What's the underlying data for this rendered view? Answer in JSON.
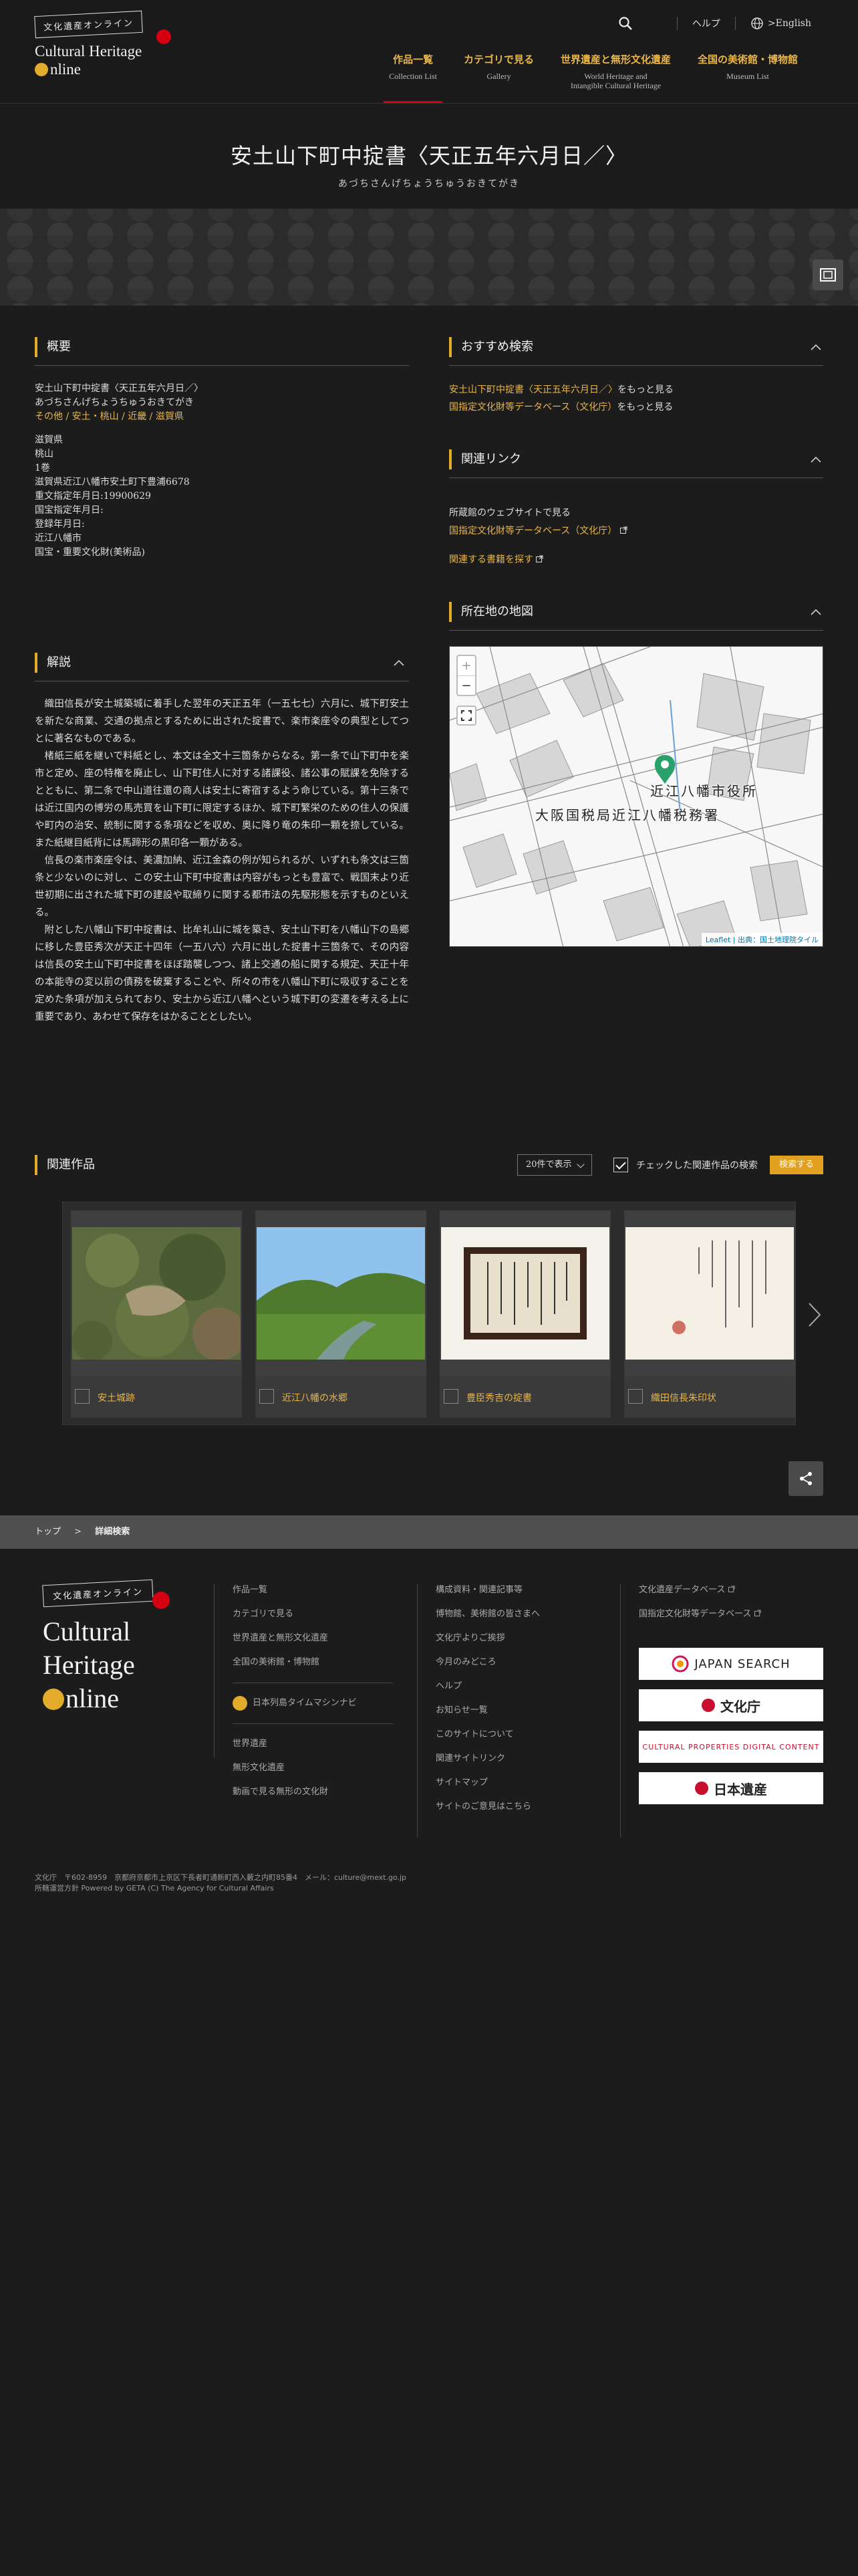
{
  "header": {
    "logo_badge": "文化遺産オンライン",
    "logo_en_1": "Cultural Heritage",
    "logo_en_2": "nline",
    "help": "ヘルプ",
    "lang": ">English",
    "nav": [
      {
        "jp": "作品一覧",
        "en": "Collection List"
      },
      {
        "jp": "カテゴリで見る",
        "en": "Gallery"
      },
      {
        "jp": "世界遺産と無形文化遺産",
        "en": "World Heritage and",
        "en2": "Intangible Cultural Heritage"
      },
      {
        "jp": "全国の美術館・博物館",
        "en": "Museum List"
      }
    ]
  },
  "title": {
    "main": "安土山下町中掟書〈天正五年六月日／〉",
    "kana": "あづちさんげちょうちゅうおきてがき"
  },
  "overview": {
    "heading": "概要",
    "lines_a": [
      "安土山下町中掟書〈天正五年六月日／〉",
      "あづちさんげちょうちゅうおきてがき"
    ],
    "category_link": "その他 / 安土・桃山 / 近畿 / 滋賀県",
    "lines_b": [
      "滋賀県",
      "桃山",
      "1巻",
      "滋賀県近江八幡市安土町下豊浦6678",
      "重文指定年月日:19900629",
      "国宝指定年月日:",
      "登録年月日:",
      "近江八幡市",
      "国宝・重要文化財(美術品)"
    ]
  },
  "commentary": {
    "heading": "解説",
    "paragraphs": [
      "織田信長が安土城築城に着手した翌年の天正五年（一五七七）六月に、城下町安土を新たな商業、交通の拠点とするために出された掟書で、楽市楽座令の典型としてつとに著名なものである。",
      "楮紙三紙を継いで料紙とし、本文は全文十三箇条からなる。第一条で山下町中を楽市と定め、座の特権を廃止し、山下町住人に対する諸課役、諸公事の賦課を免除するとともに、第二条で中山道往還の商人は安土に寄宿するよう命じている。第十三条では近江国内の博労の馬売買を山下町に限定するほか、城下町繁栄のための住人の保護や町内の治安、統制に関する条項などを収め、奥に降り竜の朱印一顆を捺している。また紙継目紙背には馬蹄形の黒印各一顆がある。",
      "信長の楽市楽座令は、美濃加納、近江金森の例が知られるが、いずれも条文は三箇条と少ないのに対し、この安土山下町中掟書は内容がもっとも豊富で、戦国末より近世初期に出された城下町の建設や取締りに関する都市法の先駆形態を示すものといえる。",
      "附とした八幡山下町中掟書は、比牟礼山に城を築き、安土山下町を八幡山下の島郷に移した豊臣秀次が天正十四年（一五八六）六月に出した掟書十三箇条で、その内容は信長の安土山下町中掟書をほぼ踏襲しつつ、諸上交通の船に関する規定、天正十年の本能寺の変以前の債務を破棄することや、所々の市を八幡山下町に吸収することを定めた条項が加えられており、安土から近江八幡へという城下町の変遷を考える上に重要であり、あわせて保存をはかることとしたい。"
    ]
  },
  "recommend": {
    "heading": "おすすめ検索",
    "items": [
      {
        "link": "安土山下町中掟書〈天正五年六月日／〉",
        "suffix": "をもっと見る"
      },
      {
        "link": "国指定文化財等データベース（文化庁）",
        "suffix": "をもっと見る"
      }
    ]
  },
  "links": {
    "heading": "関連リンク",
    "site_label": "所蔵館のウェブサイトで見る",
    "db_link": "国指定文化財等データベース（文化庁）",
    "books_link": "関連する書籍を探す"
  },
  "map": {
    "heading": "所在地の地図",
    "label1": "近江八幡市役所",
    "label2": "大阪国税局近江八幡税務署",
    "zoom_in": "+",
    "zoom_out": "−",
    "attribution": "Leaflet | 出典：国土地理院タイル"
  },
  "related": {
    "heading": "関連作品",
    "per_page": "20件で表示",
    "check_label": "チェックした関連作品の検索",
    "search_btn": "検索する",
    "items": [
      "安土城跡",
      "近江八幡の水郷",
      "豊臣秀吉の掟書",
      "織田信長朱印状"
    ]
  },
  "breadcrumb": {
    "top": "トップ",
    "sep": ">",
    "current": "詳細検索"
  },
  "footer": {
    "badge": "文化遺産オンライン",
    "big1": "Cultural",
    "big2": "Heritage",
    "big3": "nline",
    "col1a": [
      "作品一覧",
      "カテゴリで見る",
      "世界遺産と無形文化遺産",
      "全国の美術館・博物館"
    ],
    "timemachine": "日本列島タイムマシンナビ",
    "col1b": [
      "世界遺産",
      "無形文化遺産",
      "動画で見る無形の文化財"
    ],
    "col2": [
      "構成資料・関連記事等",
      "博物館、美術館の皆さまへ",
      "文化庁よりご挨拶",
      "今月のみどころ",
      "ヘルプ",
      "お知らせ一覧",
      "このサイトについて",
      "関連サイトリンク",
      "サイトマップ",
      "サイトのご意見はこちら"
    ],
    "col3": [
      "文化遺産データベース",
      "国指定文化財等データベース"
    ],
    "banners": [
      "JAPAN SEARCH",
      "文化庁",
      "CULTURAL PROPERTIES DIGITAL CONTENT",
      "日本遺産"
    ],
    "address": "文化庁　〒602-8959　京都府京都市上京区下長者町通新町西入藪之内町85番4　メール：culture@mext.go.jp",
    "copyright": "所轄運営方針 Powered by GETA (C) The Agency for Cultural Affairs"
  }
}
